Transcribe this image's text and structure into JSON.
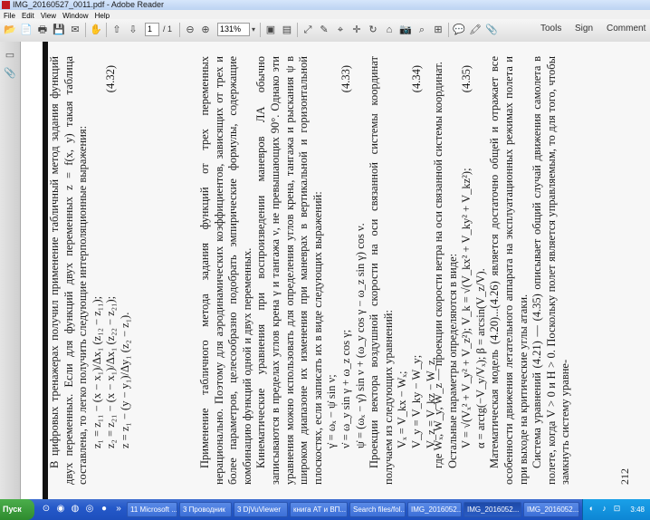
{
  "window": {
    "title": "IMG_20160527_0011.pdf - Adobe Reader"
  },
  "menu": [
    "File",
    "Edit",
    "View",
    "Window",
    "Help"
  ],
  "toolbar": {
    "page_current": "1",
    "page_total": "/ 1",
    "zoom": "131%",
    "tools_label": "Tools",
    "sign_label": "Sign",
    "comment_label": "Comment"
  },
  "document": {
    "page_number": "212",
    "columns": [
      [
        {
          "t": "p",
          "text": "В цифровых тренажерах получил применение табличный метод задания функций двух переменных. Если для функций двух переменных z = f(x, y) такая таблица составлена, то легко получить следующие интерполяционные выражения:"
        },
        {
          "t": "eq",
          "text": "z₁ = z₁₁ − (x − x₁)/Δx₁ (z₁₂ − z₁₁);"
        },
        {
          "t": "eq",
          "text": "z₂ = z₂₁ − (x − x₁)/Δx₁ (z₂₂ − z₂₁);",
          "num": "(4.32)"
        },
        {
          "t": "eq",
          "text": "z = z₁ − (y − y₁)/Δy₁ (z₂ − z₁)."
        }
      ],
      [
        {
          "t": "p",
          "text": "Применение табличного метода задания функций от трех переменных нерационально. Поэтому для аэродинамических коэффициентов, зависящих от трех и более параметров, целесообразно подобрать эмпирические формулы, содержащие комбинацию функций одной и двух переменных."
        },
        {
          "t": "p",
          "text": "Кинематические уравнения при воспроизведении маневров ЛА обычно записываются в пределах углов крена γ и тангажа ν, не превышающих 90°. Однако эти уравнения можно использовать для определения углов крена, тангажа и рыскания ψ в широком диапазоне их изменения при маневрах в вертикальной и горизонтальной плоскостях, если записать их в виде следующих выражений:"
        },
        {
          "t": "eq",
          "text": "γ̇ = ωₓ − ψ̇ sin ν;"
        },
        {
          "t": "eq",
          "text": "ν̇ = ω_y sin γ + ω_z cos γ;",
          "num": "(4.33)"
        },
        {
          "t": "eq",
          "text": "ψ̇ = (ωₓ − γ̇) sin ν + (ω_y cos γ − ω_z sin γ) cos ν."
        },
        {
          "t": "p",
          "text": "Проекции вектора воздушной скорости на оси связанной системы координат получаем из следующих уравнений:"
        },
        {
          "t": "eq",
          "text": "Vₓ = V_kx − Wₓ;"
        },
        {
          "t": "eq",
          "text": "V_y = V_ky − W_y;",
          "num": "(4.34)"
        },
        {
          "t": "eq",
          "text": "V_z = V_kz − W_z,"
        }
      ],
      [
        {
          "t": "p",
          "text": "где Wₓ, W_y, W_z — проекции скорости ветра на оси связанной системы координат."
        },
        {
          "t": "p",
          "text": "Остальные параметры определяются в виде:"
        },
        {
          "t": "eq",
          "text": "V = √(Vₓ² + V_y² + V_z²);  V_k = √(V_kx² + V_ky² + V_kz²);",
          "num": "(4.35)"
        },
        {
          "t": "eq",
          "text": "α = arctg(−V_y/Vₓ);  β = arcsin(V_z/V)."
        },
        {
          "t": "p",
          "text": "Математическая модель (4.20)...(4.26) является достаточно общей и отражает все особенности движения летательного аппарата на эксплуатационных режимах полета и при выходе на критические углы атаки."
        },
        {
          "t": "p",
          "text": "Система уравнений (4.21) — (4.35) описывает общий случай движения самолета в полете, когда V > 0 и H > 0. Поскольку полет является управляемым, то для того, чтобы замкнуть систему уравне-"
        }
      ]
    ]
  },
  "taskbar": {
    "start_label": "Пуск",
    "tasks": [
      "11 Microsoft ...",
      "3 Проводник",
      "3 DjVuViewer",
      "книга АТ и ВП...",
      "Search files/fol...",
      "IMG_2016052...",
      "IMG_2016052...",
      "IMG_2016052..."
    ],
    "clock": "3:48"
  }
}
